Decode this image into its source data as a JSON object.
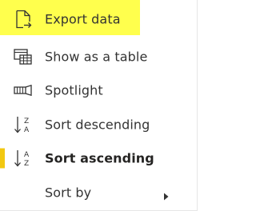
{
  "menu": {
    "items": [
      {
        "label": "Export data",
        "icon": "export-data-icon"
      },
      {
        "label": "Show as a table",
        "icon": "table-icon"
      },
      {
        "label": "Spotlight",
        "icon": "spotlight-icon"
      },
      {
        "label": "Sort descending",
        "icon": "sort-descending-icon",
        "letters_top": "Z",
        "letters_bottom": "A"
      },
      {
        "label": "Sort ascending",
        "icon": "sort-ascending-icon",
        "letters_top": "A",
        "letters_bottom": "Z",
        "active": true
      },
      {
        "label": "Sort by",
        "icon": "none",
        "has_submenu": true
      }
    ],
    "colors": {
      "highlight": "#ffff4d",
      "active_bar": "#f2c811",
      "text": "#333333"
    }
  }
}
